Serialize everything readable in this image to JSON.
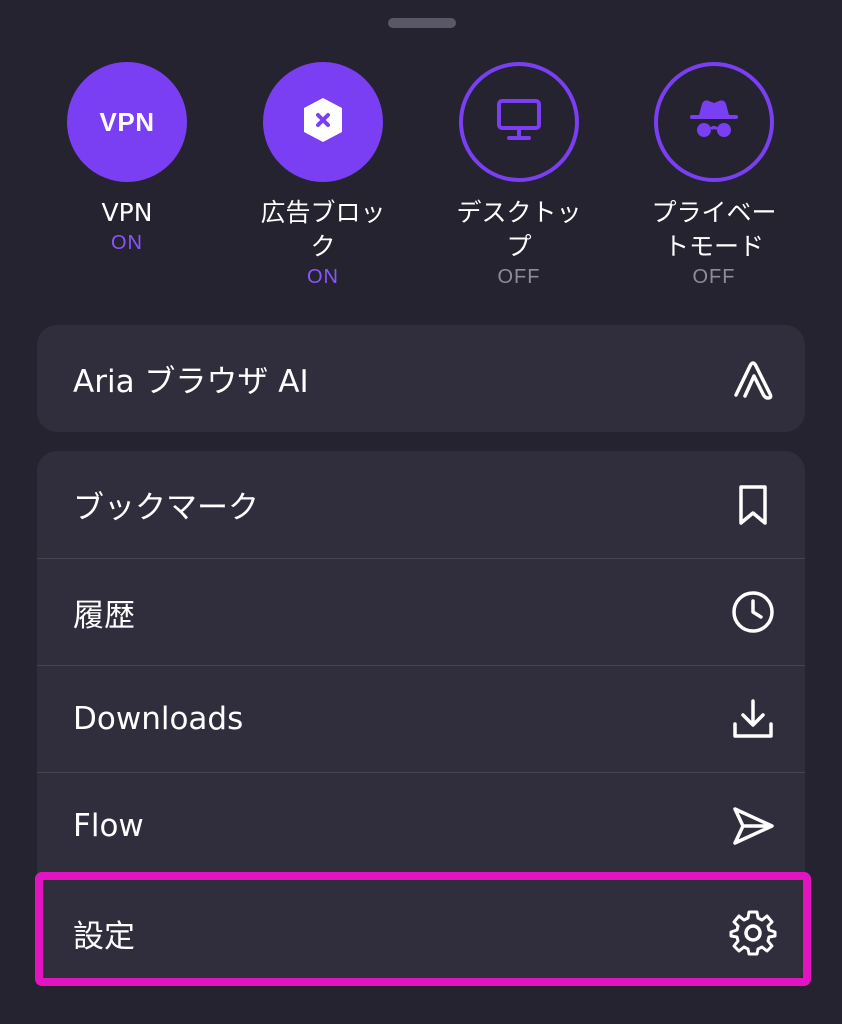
{
  "quick_toggles": [
    {
      "id": "vpn",
      "icon_text": "VPN",
      "label": "VPN",
      "state": "ON",
      "active": true,
      "icon": "vpn-badge-icon"
    },
    {
      "id": "adblock",
      "label": "広告ブロック",
      "state": "ON",
      "active": true,
      "icon": "adblock-shield-icon"
    },
    {
      "id": "desktop",
      "label": "デスクトップ",
      "state": "OFF",
      "active": false,
      "icon": "desktop-monitor-icon"
    },
    {
      "id": "private",
      "label": "プライベートモード",
      "state": "OFF",
      "active": false,
      "icon": "incognito-icon"
    }
  ],
  "ai_card": {
    "label": "Aria ブラウザ AI",
    "icon": "aria-logo-icon"
  },
  "menu": [
    {
      "label": "ブックマーク",
      "icon": "bookmark-icon"
    },
    {
      "label": "履歴",
      "icon": "clock-icon"
    },
    {
      "label": "Downloads",
      "icon": "download-icon"
    },
    {
      "label": "Flow",
      "icon": "send-icon"
    },
    {
      "label": "設定",
      "icon": "gear-icon",
      "highlighted": true
    }
  ],
  "colors": {
    "background": "#25232f",
    "card": "#302e3c",
    "accent": "#7a3ff2",
    "state_on": "#8a55ff",
    "state_off": "#8e8c98",
    "highlight": "#e313c2"
  }
}
